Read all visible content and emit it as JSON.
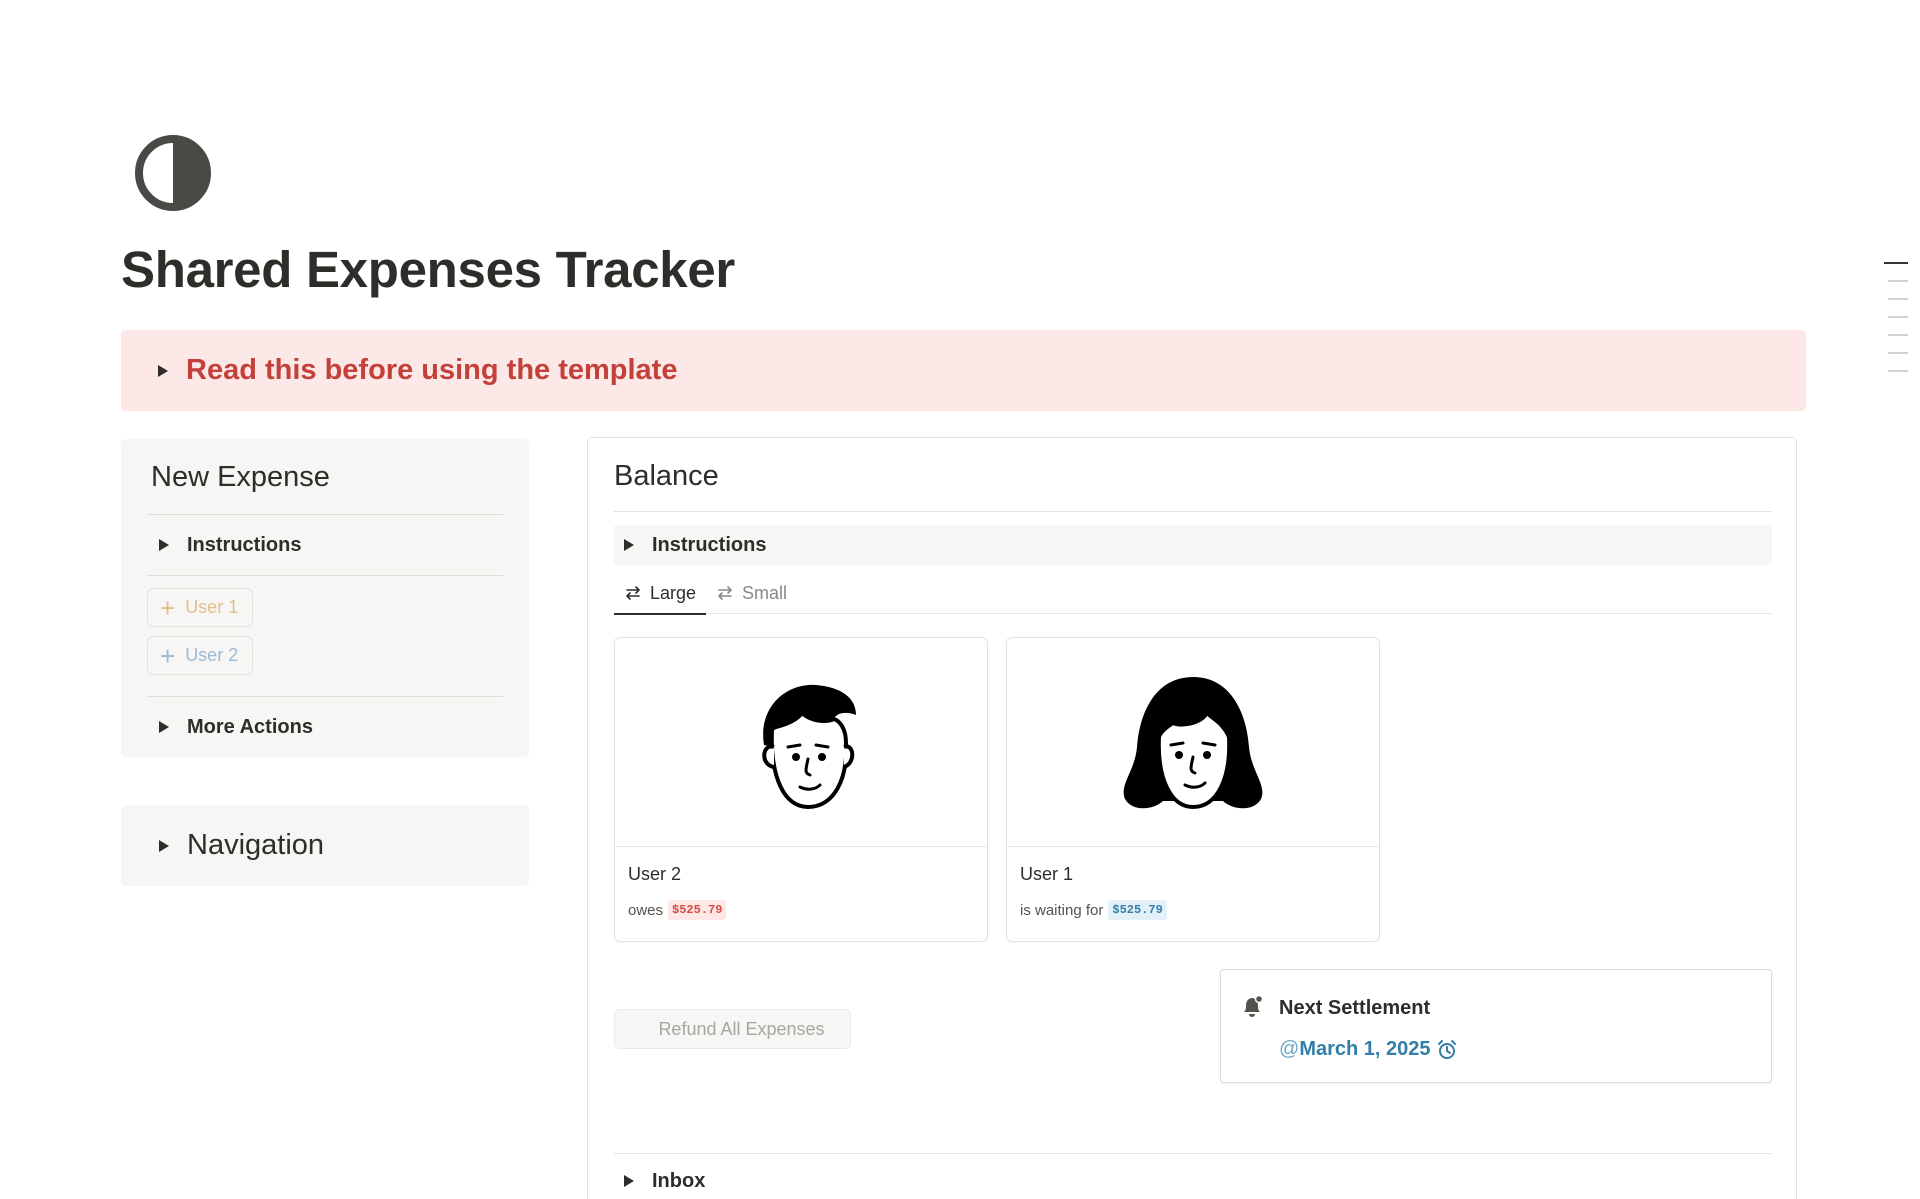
{
  "page": {
    "icon": "half-circle-icon",
    "title": "Shared Expenses Tracker"
  },
  "callout": {
    "text": "Read this before using the template",
    "color": "#c4403a",
    "background": "#fce8e7"
  },
  "new_expense": {
    "title": "New Expense",
    "instructions_label": "Instructions",
    "buttons": [
      {
        "label": "User 1",
        "icon": "plus-icon",
        "color": "#e0c08a"
      },
      {
        "label": "User 2",
        "icon": "plus-icon",
        "color": "#9bbad6"
      }
    ],
    "more_actions_label": "More Actions"
  },
  "navigation": {
    "label": "Navigation"
  },
  "balance": {
    "title": "Balance",
    "instructions_label": "Instructions",
    "tabs": [
      {
        "label": "Large",
        "icon": "swap-arrows-icon",
        "active": true
      },
      {
        "label": "Small",
        "icon": "swap-arrows-icon",
        "active": false
      }
    ],
    "cards": [
      {
        "name": "User 2",
        "status_text": "owes",
        "amount": "$525.79",
        "amount_color": "#d44c47",
        "avatar": "man-face-icon"
      },
      {
        "name": "User 1",
        "status_text": "is waiting for",
        "amount": "$525.79",
        "amount_color": "#337ea9",
        "avatar": "woman-face-icon"
      }
    ],
    "refund_button": "Refund All Expenses",
    "settlement": {
      "icon": "bell-icon",
      "title": "Next Settlement",
      "at": "@",
      "date": "March 1, 2025",
      "reminder_icon": "alarm-clock-icon"
    },
    "inbox_label": "Inbox"
  }
}
